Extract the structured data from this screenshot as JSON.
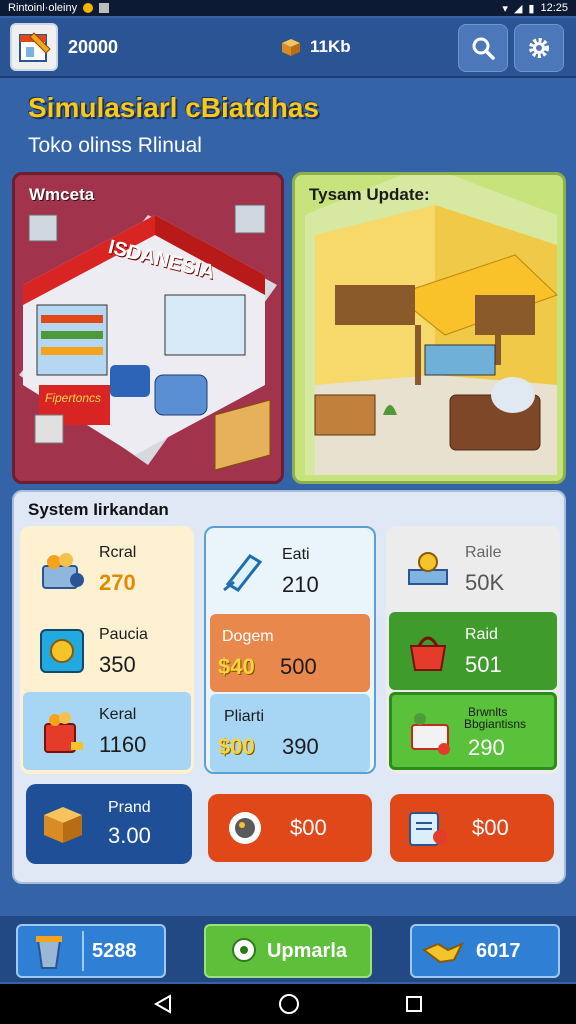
{
  "status_bar": {
    "left_text": "Rintoinl·oleiny",
    "time": "12:25"
  },
  "header": {
    "coins": "20000",
    "center_stat": "11Kb"
  },
  "title": "Simulasiarl cBiatdhas",
  "subtitle": "Toko olinss Rlinual",
  "cards": {
    "left_label": "Wmceta",
    "right_label": "Tysam Update:"
  },
  "illustration_text": {
    "shop_sign": "ISDANESIA",
    "counter_sign": "Fipertoncs"
  },
  "panel": {
    "title": "System Iirkandan",
    "col1": [
      {
        "label": "Rcral",
        "value": "270"
      },
      {
        "label": "Paucia",
        "value": "350"
      },
      {
        "label": "Keral",
        "value": "1160"
      }
    ],
    "col2": [
      {
        "label": "Eati",
        "value": "210"
      },
      {
        "label": "Dogem",
        "prefix": "$40",
        "value": "500"
      },
      {
        "label": "Pliarti",
        "prefix": "$00",
        "value": "390"
      }
    ],
    "col3": [
      {
        "label": "Raile",
        "value": "50K"
      },
      {
        "label": "Raid",
        "value": "501"
      },
      {
        "label": "Brwnlts",
        "label2": "Bbgiantisns",
        "value": "290"
      }
    ],
    "actions": [
      {
        "label": "Prand",
        "value": "3.00"
      },
      {
        "value": "$00"
      },
      {
        "value": "$00"
      }
    ]
  },
  "bottom": {
    "left_value": "5288",
    "center_label": "Upmarla",
    "right_value": "6017"
  },
  "colors": {
    "accent_gold": "#f9c914",
    "orange": "#e38b00",
    "green": "#3f9b2c",
    "red": "#e04719",
    "blue": "#1f4f96"
  }
}
